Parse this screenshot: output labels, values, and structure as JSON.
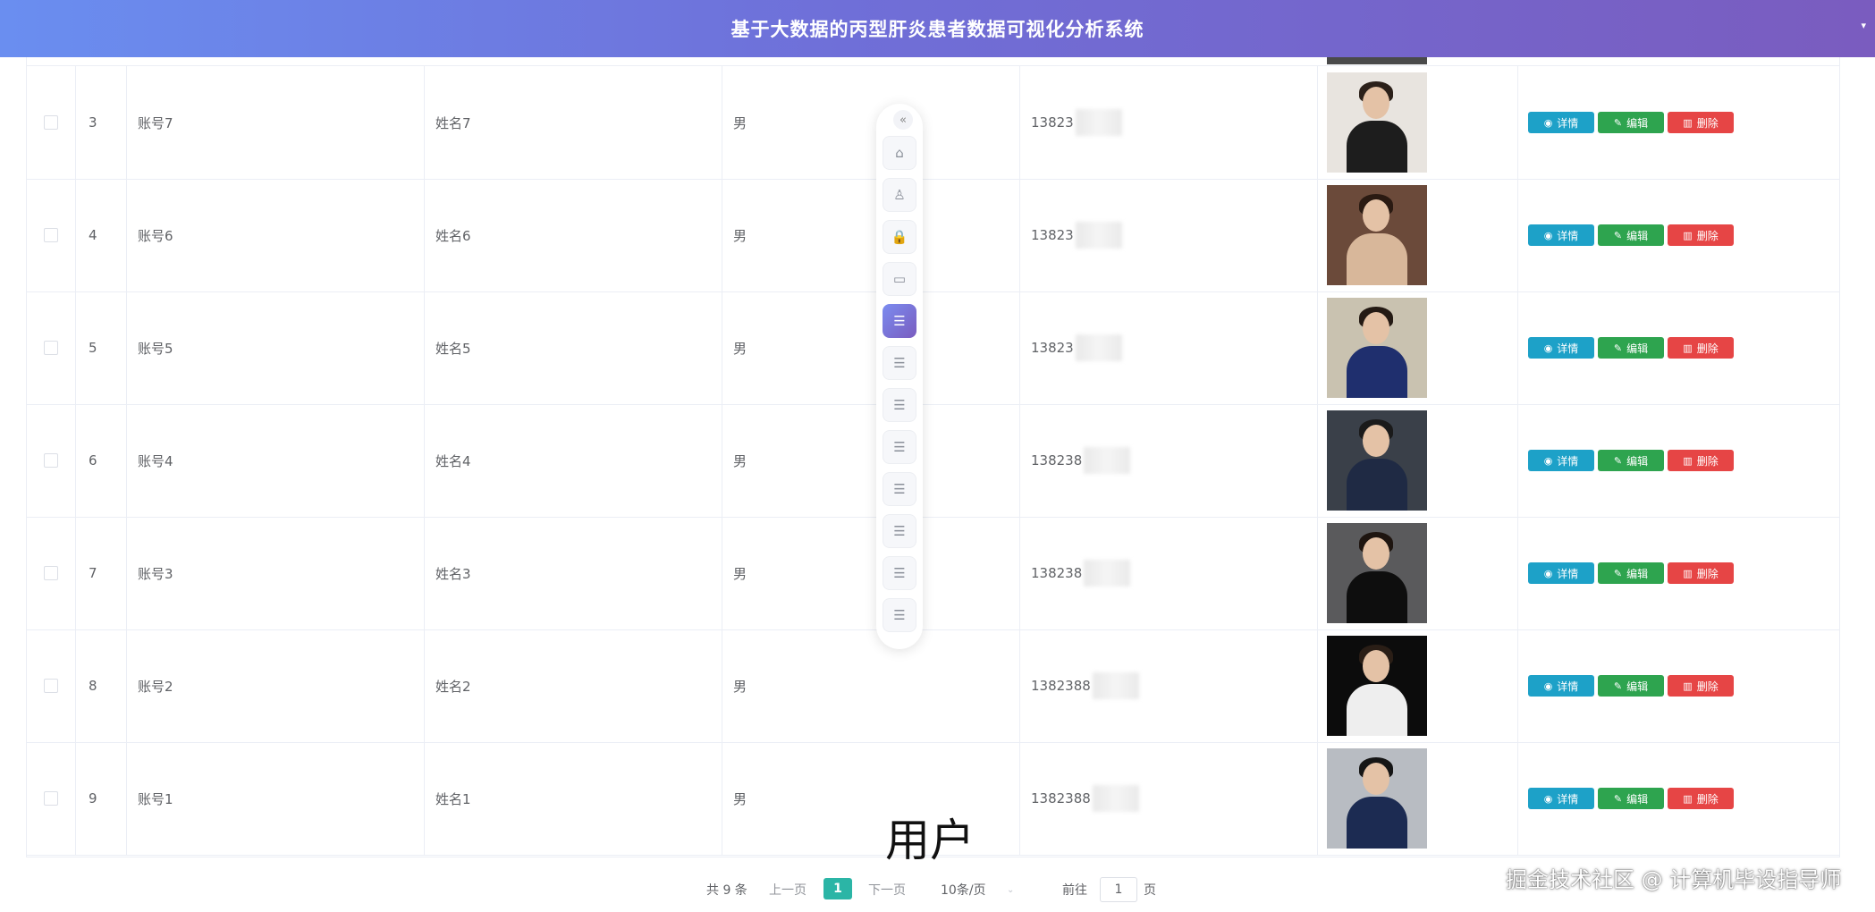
{
  "header": {
    "title": "基于大数据的丙型肝炎患者数据可视化分析系统",
    "caret": "▾"
  },
  "table": {
    "rows": [
      {
        "index": "3",
        "account": "账号7",
        "name": "姓名7",
        "gender": "男",
        "phone": "13823",
        "photo_desc": "woman-black-suit"
      },
      {
        "index": "4",
        "account": "账号6",
        "name": "姓名6",
        "gender": "男",
        "phone": "13823",
        "photo_desc": "woman-at-desk"
      },
      {
        "index": "5",
        "account": "账号5",
        "name": "姓名5",
        "gender": "男",
        "phone": "13823",
        "photo_desc": "woman-bookshelf"
      },
      {
        "index": "6",
        "account": "账号4",
        "name": "姓名4",
        "gender": "男",
        "phone": "138238",
        "photo_desc": "man-navy-suit"
      },
      {
        "index": "7",
        "account": "账号3",
        "name": "姓名3",
        "gender": "男",
        "phone": "138238",
        "photo_desc": "woman-black-dress"
      },
      {
        "index": "8",
        "account": "账号2",
        "name": "姓名2",
        "gender": "男",
        "phone": "1382388",
        "photo_desc": "woman-white-blazer"
      },
      {
        "index": "9",
        "account": "账号1",
        "name": "姓名1",
        "gender": "男",
        "phone": "1382388",
        "photo_desc": "man-glasses-suit"
      }
    ],
    "actions": {
      "detail": "详情",
      "edit": "编辑",
      "delete": "删除"
    }
  },
  "dock": {
    "collapse": "«",
    "items": [
      {
        "icon": "home-icon",
        "glyph": "⌂"
      },
      {
        "icon": "user-icon",
        "glyph": "♙"
      },
      {
        "icon": "lock-icon",
        "glyph": "🔒"
      },
      {
        "icon": "board-icon",
        "glyph": "▭"
      },
      {
        "icon": "document-icon",
        "glyph": "☰",
        "active": true
      },
      {
        "icon": "document-icon",
        "glyph": "☰"
      },
      {
        "icon": "document-icon",
        "glyph": "☰"
      },
      {
        "icon": "document-icon",
        "glyph": "☰"
      },
      {
        "icon": "document-icon",
        "glyph": "☰"
      },
      {
        "icon": "document-icon",
        "glyph": "☰"
      },
      {
        "icon": "document-icon",
        "glyph": "☰"
      },
      {
        "icon": "document-icon",
        "glyph": "☰"
      }
    ]
  },
  "caption": "用户",
  "pagination": {
    "total": "共 9 条",
    "prev": "上一页",
    "current_page": "1",
    "next": "下一页",
    "page_size": "10条/页",
    "goto_label": "前往",
    "goto_value": "1",
    "page_suffix": "页"
  },
  "watermark": "掘金技术社区 @ 计算机毕设指导师",
  "colors": {
    "header_start": "#6a8ef0",
    "header_end": "#7a5cbf",
    "detail": "#1da1c8",
    "edit": "#2ea44f",
    "delete": "#e64545",
    "page_active": "#2bb5a6"
  }
}
